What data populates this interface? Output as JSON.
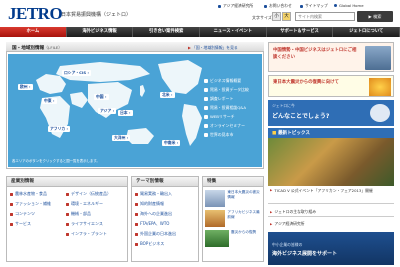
{
  "header": {
    "logo": "JETRO",
    "org_name": "日本貿易振興機構（ジェトロ）",
    "util_links": [
      "アジア経済研究所",
      "お問い合わせ",
      "サイトマップ",
      "Global Home"
    ],
    "font_size_label": "文字サイズ",
    "font_size_small": "小",
    "font_size_large": "大",
    "search_placeholder": "サイト内検索",
    "search_button": "検索"
  },
  "nav": {
    "items": [
      "ホーム",
      "海外ビジネス情報",
      "引き合い案件検索",
      "ニュース・イベント",
      "サポート＆サービス",
      "ジェトロについて"
    ]
  },
  "map": {
    "title": "国・地域別情報",
    "title_sub": "（J-FILE）",
    "link": "「国・地域別情報」を見る",
    "regions": [
      "欧州",
      "ロシア・CIS",
      "中東",
      "北米",
      "中国",
      "アジア",
      "日本",
      "アフリカ",
      "大洋州",
      "中南米"
    ],
    "menu": [
      "ビジネス情報概要",
      "貿易・投資データ比較",
      "調査レポート",
      "貿易・投資相談Q&A",
      "WEBリサーチ",
      "オンラインセミナー",
      "世界の見本市"
    ],
    "note": "各エリアのボタンをクリックすると国一覧を表示します。"
  },
  "industry": {
    "title": "産業別情報",
    "col1": [
      "農林水産物・食品",
      "ファッション・繊維",
      "コンテンツ",
      "サービス"
    ],
    "col2": [
      "デザイン（伝統産品）",
      "環境・エネルギー",
      "機械・部品",
      "ライフサイエンス",
      "インフラ・プラント"
    ]
  },
  "theme": {
    "title": "テーマ別情報",
    "items": [
      "貿易実務・輸出入",
      "知的財産情報",
      "海外への企業進出",
      "FTA/EPA、WTO",
      "外国企業の日本進出",
      "BOPビジネス"
    ]
  },
  "feature": {
    "title": "特集",
    "items": [
      "東日本大震災の被災情報",
      "アフリカビジネス最前線",
      "震災からの復興"
    ]
  },
  "sidebar": {
    "banner1": "中国情勢・中国ビジネスはジェトロにご相談ください",
    "banner2": "東日本大震災からの復興に向けて",
    "banner3_small": "ジェトロに今",
    "banner3": "どんなことでしょう?",
    "news_title": "最新トピックス",
    "news_caption": "TICAD V 公式イベント「アフリカン・フェア2013」開催",
    "links": [
      "ジェトロの主な取り組み",
      "アジア経済研究所"
    ],
    "bottom_small": "中小企業の皆様の",
    "bottom": "海外ビジネス展開をサポート"
  }
}
